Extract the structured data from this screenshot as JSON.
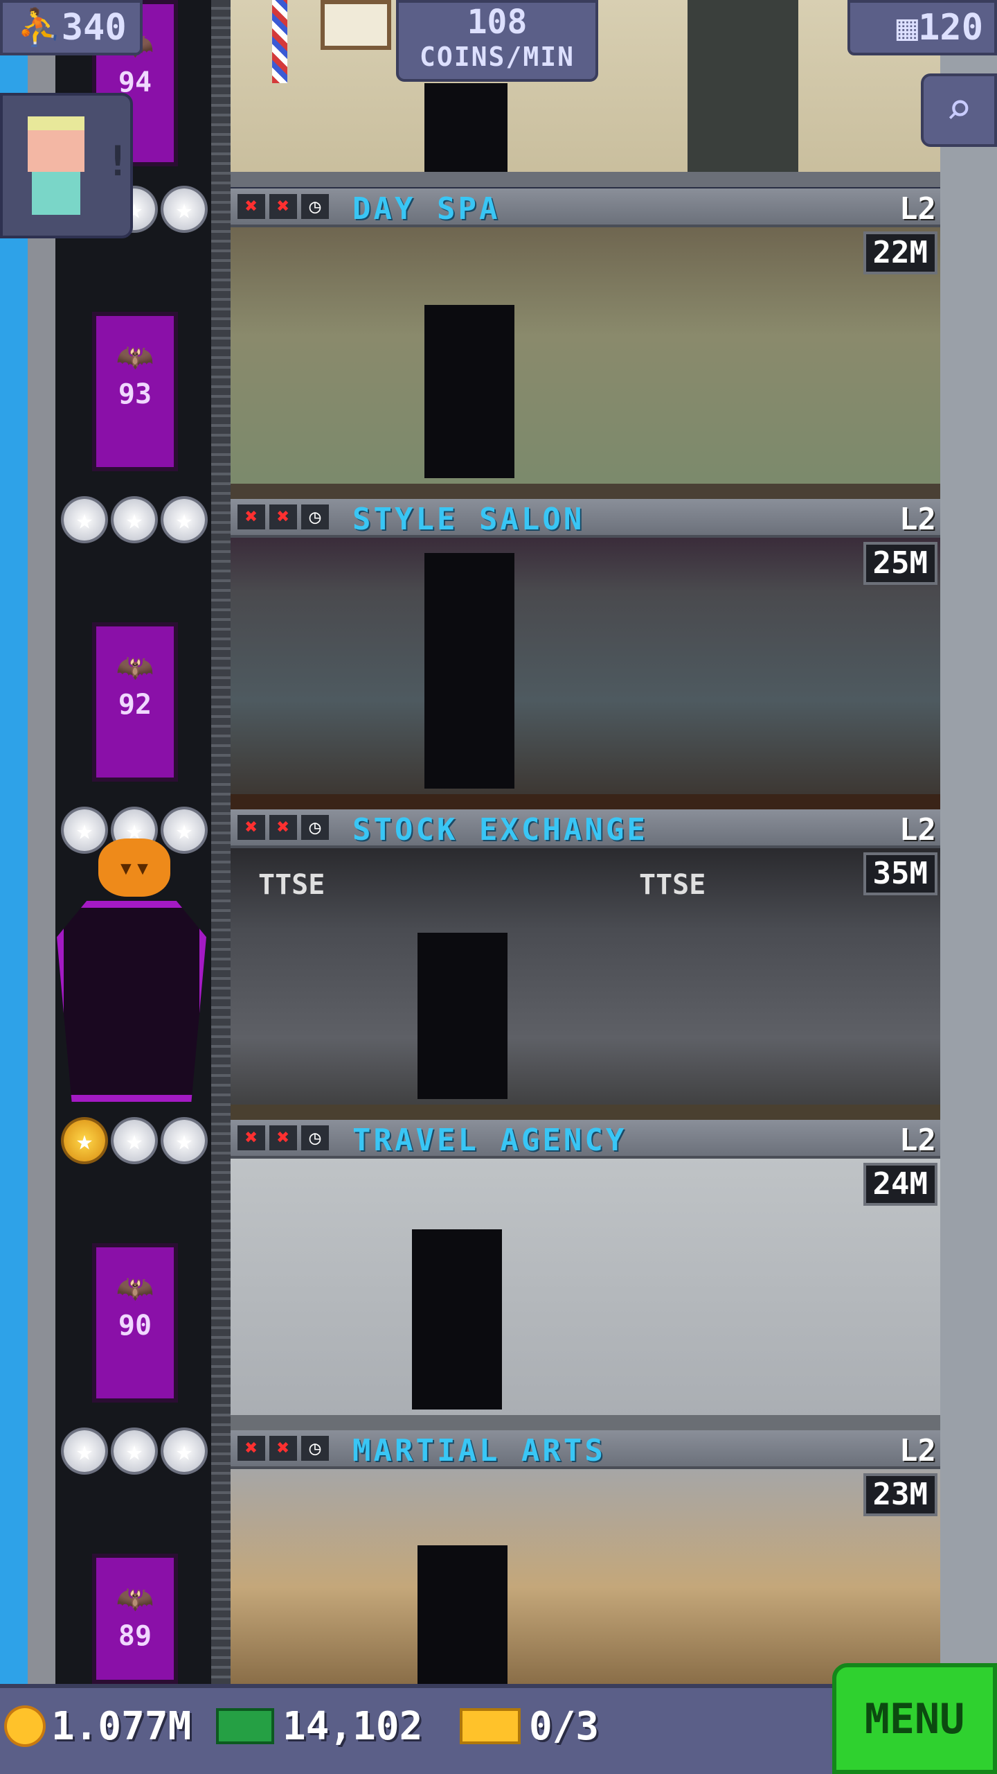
{
  "hud": {
    "population": "340",
    "coins_per_min_value": "108",
    "coins_per_min_unit": "COINS/MIN",
    "floor_count": "120"
  },
  "floors": [
    {
      "number": "93",
      "name": "DAY SPA",
      "level": "L2",
      "price": "22M",
      "stars": 0
    },
    {
      "number": "92",
      "name": "STYLE SALON",
      "level": "L2",
      "price": "25M",
      "stars": 0
    },
    {
      "number": "",
      "name": "STOCK EXCHANGE",
      "level": "L2",
      "price": "35M",
      "stars": 0,
      "signs": [
        "TTSE",
        "TTSE"
      ]
    },
    {
      "number": "90",
      "name": "TRAVEL AGENCY",
      "level": "L2",
      "price": "24M",
      "stars": 1
    },
    {
      "number": "89",
      "name": "MARTIAL ARTS",
      "level": "L2",
      "price": "23M",
      "stars": 0
    }
  ],
  "top_elevator_number": "94",
  "bottom_bar": {
    "coins": "1.077M",
    "bux": "14,102",
    "tickets": "0/3",
    "menu_label": "MENU"
  },
  "colors": {
    "floor_name": "#39c6f5",
    "elevator": "#8a10a8",
    "menu_button": "#2fd12f",
    "hud_panel": "#5b5f88",
    "sky": "#2ea2e8"
  },
  "icons": {
    "population": "person-icon",
    "floors": "building-icon",
    "search": "magnifier-icon",
    "coin": "coin-icon",
    "bux": "bux-icon",
    "ticket": "ticket-icon"
  }
}
